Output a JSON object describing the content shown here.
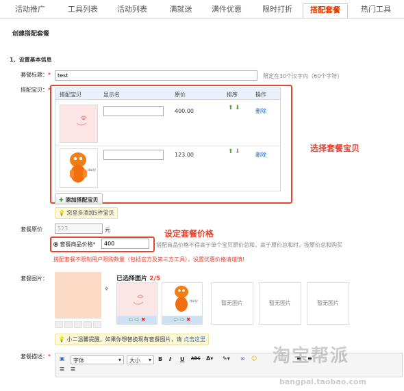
{
  "tabs": [
    {
      "label": "活动推广"
    },
    {
      "label": "工具列表"
    },
    {
      "label": "活动列表"
    },
    {
      "label": "满就送"
    },
    {
      "label": "满件优惠"
    },
    {
      "label": "限时打折"
    },
    {
      "label": "搭配套餐",
      "active": true
    },
    {
      "label": "热门工具"
    }
  ],
  "page_title": "创建搭配套餐",
  "section_title": "1、设置基本信息",
  "package_title": {
    "label": "套餐标题：",
    "value": "test",
    "hint": "限定在30个汉字内（60个字符）"
  },
  "items": {
    "label": "搭配宝贝：",
    "headers": [
      "搭配宝贝",
      "显示名",
      "原价",
      "排序",
      "操作"
    ],
    "rows": [
      {
        "name": "",
        "price": "400.00",
        "delete": "删除"
      },
      {
        "name": "",
        "price": "123.00",
        "delete": "删除"
      }
    ],
    "add_button": "添加搭配宝贝",
    "add_tip": "您至多添加5件宝贝",
    "annotation": "选择套餐宝贝"
  },
  "original_price": {
    "label": "套餐原价",
    "value": "523",
    "unit": "元"
  },
  "package_price": {
    "label": "套餐商品价格*",
    "value": "400",
    "hint": "搭配商品价格不得高于单个宝贝原价总和，高于原价总和时，按原价总和购买",
    "warning": "搭配套餐不限制用户限购数量（包括官方及第三方工具），设置优惠价格请谨慎!",
    "annotation": "设定套餐价格"
  },
  "images": {
    "label": "套餐图片：",
    "selected_label": "已选择图片",
    "selected_count": "2/5",
    "empty_label": "暂无图片",
    "tip_text": "小二温馨提醒，如果你想替换现有套餐图片，请",
    "tip_link": "点击这里"
  },
  "description": {
    "label": "套餐描述：",
    "font_label": "字体",
    "size_label": "大小",
    "tools": [
      "B",
      "I",
      "U",
      "ABC"
    ]
  },
  "watermark": {
    "logo": "淘宝帮派",
    "url": "bangpai.taobao.com"
  },
  "colors": {
    "accent": "#e8412f",
    "link": "#2b6cc4",
    "tab_active": "#e03a00"
  }
}
